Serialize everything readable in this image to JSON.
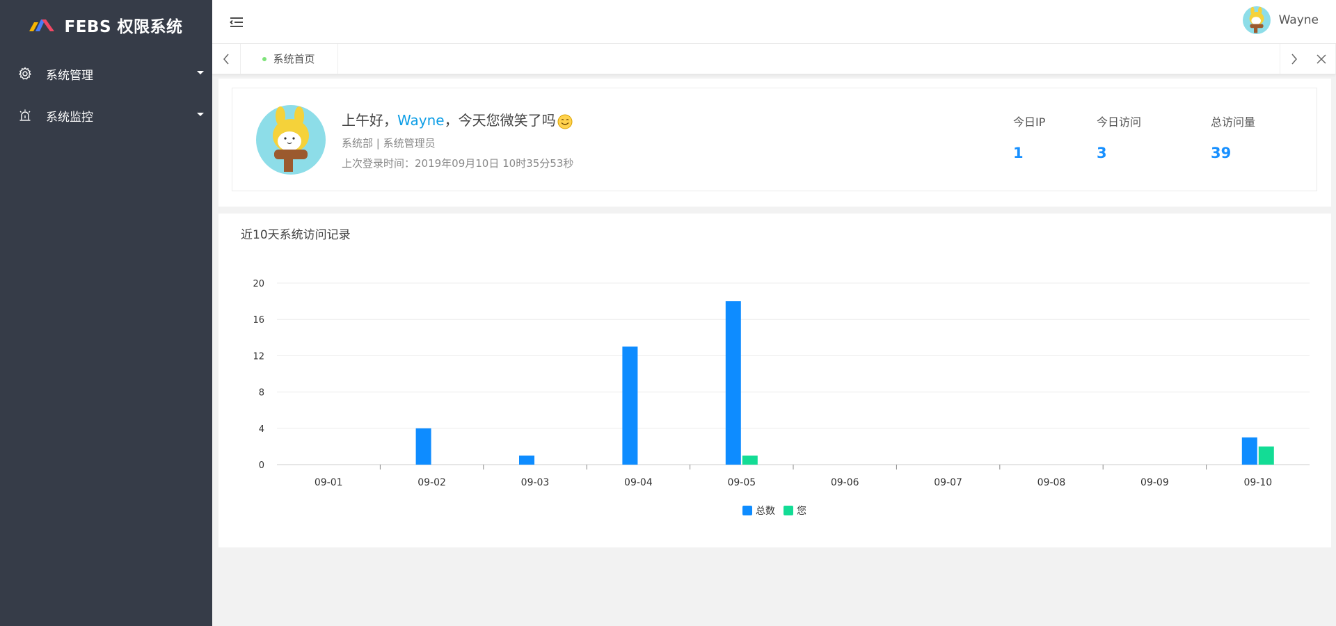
{
  "app": {
    "title": "FEBS 权限系统"
  },
  "sidebar": {
    "items": [
      {
        "label": "系统管理",
        "icon": "gear-icon"
      },
      {
        "label": "系统监控",
        "icon": "alarm-icon"
      }
    ]
  },
  "header": {
    "username": "Wayne"
  },
  "tabs": [
    {
      "label": "系统首页",
      "active": true
    }
  ],
  "welcome": {
    "greeting_prefix": "上午好，",
    "name": "Wayne",
    "greeting_suffix": "，今天您微笑了吗",
    "dept": "系统部 | 系统管理员",
    "last_login": "上次登录时间：2019年09月10日 10时35分53秒"
  },
  "stats": [
    {
      "label": "今日IP",
      "value": "1"
    },
    {
      "label": "今日访问",
      "value": "3"
    },
    {
      "label": "总访问量",
      "value": "39"
    }
  ],
  "colors": {
    "sidebar_bg": "#363c48",
    "accent": "#1890ff",
    "series_total": "#0e8cff",
    "series_you": "#13dc95"
  },
  "chart_title": "近10天系统访问记录",
  "chart_data": {
    "type": "bar",
    "categories": [
      "09-01",
      "09-02",
      "09-03",
      "09-04",
      "09-05",
      "09-06",
      "09-07",
      "09-08",
      "09-09",
      "09-10"
    ],
    "series": [
      {
        "name": "总数",
        "values": [
          0,
          4,
          1,
          13,
          18,
          0,
          0,
          0,
          0,
          3
        ],
        "color": "#0e8cff"
      },
      {
        "name": "您",
        "values": [
          0,
          0,
          0,
          0,
          1,
          0,
          0,
          0,
          0,
          2
        ],
        "color": "#13dc95"
      }
    ],
    "yticks": [
      0,
      4,
      8,
      12,
      16,
      20
    ],
    "ylim": [
      0,
      20
    ],
    "grid": true,
    "legend": "bottom-center"
  }
}
